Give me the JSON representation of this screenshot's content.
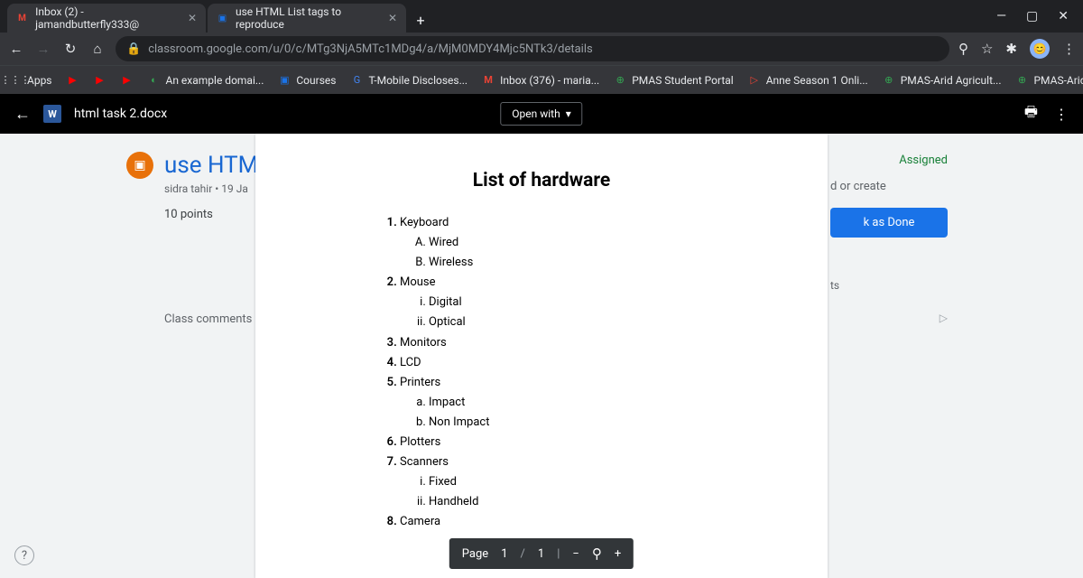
{
  "tabs": [
    {
      "favicon": "M",
      "favColor": "#ea4335",
      "title": "Inbox (2) - jamandbutterfly333@"
    },
    {
      "favicon": "▣",
      "favColor": "#1a73e8",
      "title": "use HTML List tags to reproduce"
    }
  ],
  "url": "classroom.google.com/u/0/c/MTg3NjA5MTc1MDg4/a/MjM0MDY4Mjc5NTk3/details",
  "bookmarks": [
    {
      "icon": "⋮⋮⋮",
      "label": "Apps"
    },
    {
      "icon": "▶",
      "label": ""
    },
    {
      "icon": "▶",
      "label": ""
    },
    {
      "icon": "▶",
      "label": ""
    },
    {
      "icon": "◐",
      "label": "An example domai..."
    },
    {
      "icon": "▣",
      "label": "Courses"
    },
    {
      "icon": "G",
      "label": "T-Mobile Discloses..."
    },
    {
      "icon": "M",
      "label": "Inbox (376) - maria..."
    },
    {
      "icon": "⊕",
      "label": "PMAS Student Portal"
    },
    {
      "icon": "▷",
      "label": "Anne Season 1 Onli..."
    },
    {
      "icon": "⊕",
      "label": "PMAS-Arid Agricult..."
    },
    {
      "icon": "⊕",
      "label": "PMAS-Arid Agricult..."
    }
  ],
  "doc": {
    "filename": "html task 2.docx",
    "openWith": "Open with",
    "heading": "List of hardware",
    "list": {
      "i1": "Keyboard",
      "i1a": "Wired",
      "i1b": "Wireless",
      "i2": "Mouse",
      "i2a": "Digital",
      "i2b": "Optical",
      "i3": "Monitors",
      "i4": "LCD",
      "i5": "Printers",
      "i5a": "Impact",
      "i5b": "Non Impact",
      "i6": "Plotters",
      "i7": "Scanners",
      "i7a": "Fixed",
      "i7b": "Handheld",
      "i8": "Camera"
    }
  },
  "classroom": {
    "title": "use HTM",
    "sub": "sidra tahir • 19 Ja",
    "points": "10 points",
    "comments": "Class comments",
    "assigned": "Assigned",
    "work": "d or create",
    "done": "k as Done",
    "ts": "ts",
    "private": "",
    "send": "▷"
  },
  "pager": {
    "label": "Page",
    "cur": "1",
    "sep": "/",
    "total": "1"
  }
}
